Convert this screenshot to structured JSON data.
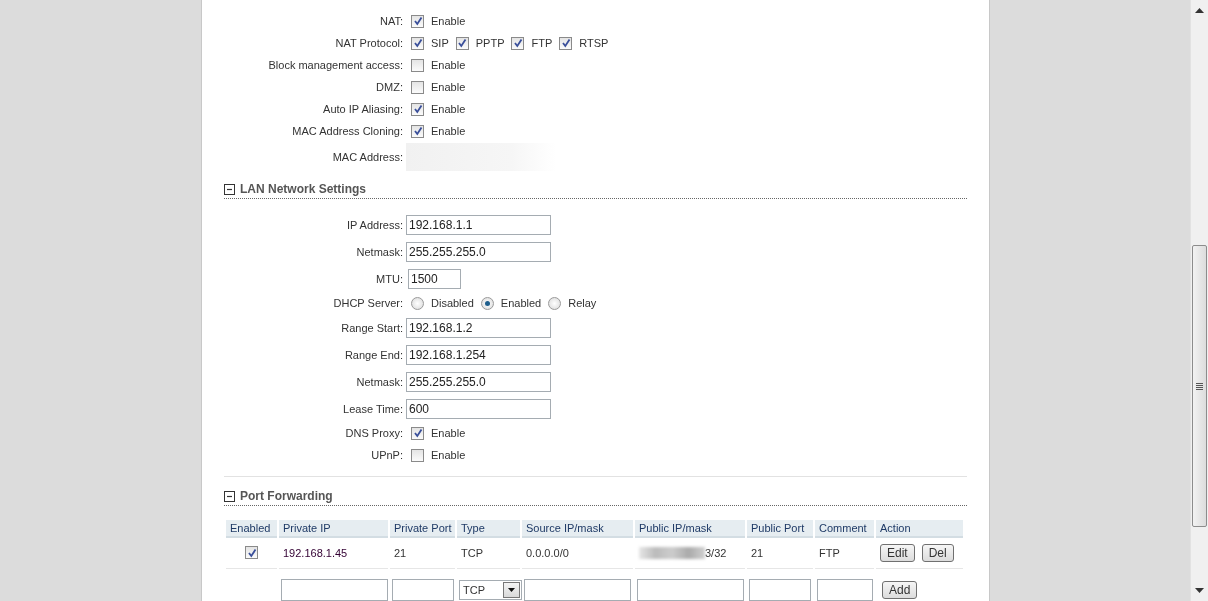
{
  "wan": {
    "rows": [
      {
        "label": "NAT:",
        "kind": "checkbox",
        "options": [
          {
            "label": "Enable",
            "checked": true
          }
        ]
      },
      {
        "label": "NAT Protocol:",
        "kind": "checkbox",
        "options": [
          {
            "label": "SIP",
            "checked": true
          },
          {
            "label": "PPTP",
            "checked": true
          },
          {
            "label": "FTP",
            "checked": true
          },
          {
            "label": "RTSP",
            "checked": true
          }
        ]
      },
      {
        "label": "Block management access:",
        "kind": "checkbox",
        "options": [
          {
            "label": "Enable",
            "checked": false
          }
        ]
      },
      {
        "label": "DMZ:",
        "kind": "checkbox",
        "options": [
          {
            "label": "Enable",
            "checked": false
          }
        ]
      },
      {
        "label": "Auto IP Aliasing:",
        "kind": "checkbox",
        "options": [
          {
            "label": "Enable",
            "checked": true
          }
        ]
      },
      {
        "label": "MAC Address Cloning:",
        "kind": "checkbox",
        "options": [
          {
            "label": "Enable",
            "checked": true
          }
        ]
      },
      {
        "label": "MAC Address:",
        "kind": "blurred"
      }
    ]
  },
  "lan": {
    "title": "LAN Network Settings",
    "expanded": true,
    "rows": [
      {
        "label": "IP Address:",
        "kind": "text",
        "value": "192.168.1.1"
      },
      {
        "label": "Netmask:",
        "kind": "text",
        "value": "255.255.255.0"
      },
      {
        "label": "MTU:",
        "kind": "short_text",
        "value": "1500"
      },
      {
        "label": "DHCP Server:",
        "kind": "radio",
        "options": [
          {
            "label": "Disabled",
            "selected": false
          },
          {
            "label": "Enabled",
            "selected": true
          },
          {
            "label": "Relay",
            "selected": false
          }
        ]
      },
      {
        "label": "Range Start:",
        "kind": "text",
        "value": "192.168.1.2"
      },
      {
        "label": "Range End:",
        "kind": "text",
        "value": "192.168.1.254"
      },
      {
        "label": "Netmask:",
        "kind": "text",
        "value": "255.255.255.0"
      },
      {
        "label": "Lease Time:",
        "kind": "text",
        "value": "600"
      },
      {
        "label": "DNS Proxy:",
        "kind": "checkbox",
        "options": [
          {
            "label": "Enable",
            "checked": true
          }
        ]
      },
      {
        "label": "UPnP:",
        "kind": "checkbox",
        "options": [
          {
            "label": "Enable",
            "checked": false
          }
        ]
      }
    ]
  },
  "port_forwarding": {
    "title": "Port Forwarding",
    "expanded": true,
    "columns": [
      "Enabled",
      "Private IP",
      "Private Port",
      "Type",
      "Source IP/mask",
      "Public IP/mask",
      "Public Port",
      "Comment",
      "Action"
    ],
    "rows": [
      {
        "enabled": true,
        "private_ip": "192.168.1.45",
        "private_port": "21",
        "type": "TCP",
        "source": "0.0.0.0/0",
        "public_ip": "3/32",
        "public_port": "21",
        "comment": "FTP",
        "actions": [
          "Edit",
          "Del"
        ]
      }
    ],
    "new_entry": {
      "type": "TCP",
      "button": "Add"
    }
  }
}
